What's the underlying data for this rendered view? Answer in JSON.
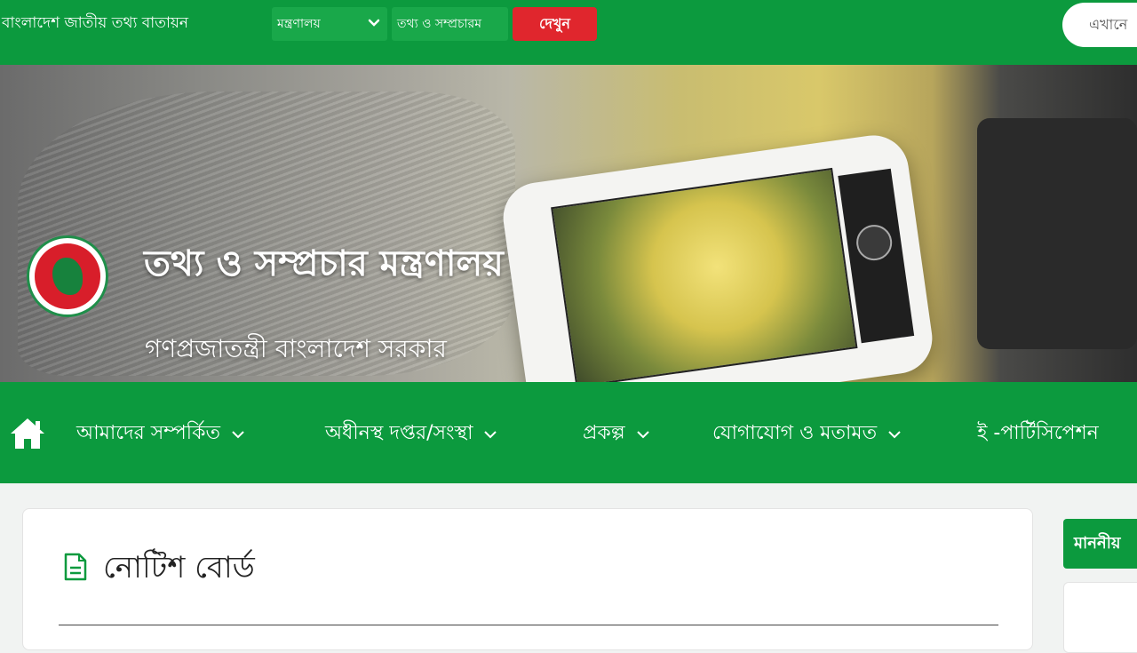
{
  "topbar": {
    "portal_title": "বাংলাদেশ জাতীয় তথ্য বাতায়ন",
    "ministry_select": "মন্ত্রণালয়",
    "office_select": "তথ্য ও সম্প্রচারম",
    "view_button": "দেখুন",
    "search_text": "এখানে"
  },
  "banner": {
    "ministry_name": "তথ্য ও সম্প্রচার মন্ত্রণালয়",
    "government_name": "গণপ্রজাতন্ত্রী বাংলাদেশ সরকার"
  },
  "nav": {
    "items": [
      {
        "label": "আমাদের সম্পর্কিত",
        "has_dropdown": true
      },
      {
        "label": "অধীনস্থ দপ্তর/সংস্থা",
        "has_dropdown": true
      },
      {
        "label": "প্রকল্প",
        "has_dropdown": true
      },
      {
        "label": "যোগাযোগ ও মতামত",
        "has_dropdown": true
      },
      {
        "label": "ই -পার্টিসিপেশন",
        "has_dropdown": false
      }
    ]
  },
  "notice_board": {
    "title": "নোটিশ বোর্ড"
  },
  "sidebar": {
    "tab_label": "মাননীয়"
  },
  "colors": {
    "brand_green": "#0c9a3e",
    "button_red": "#e0262d"
  }
}
